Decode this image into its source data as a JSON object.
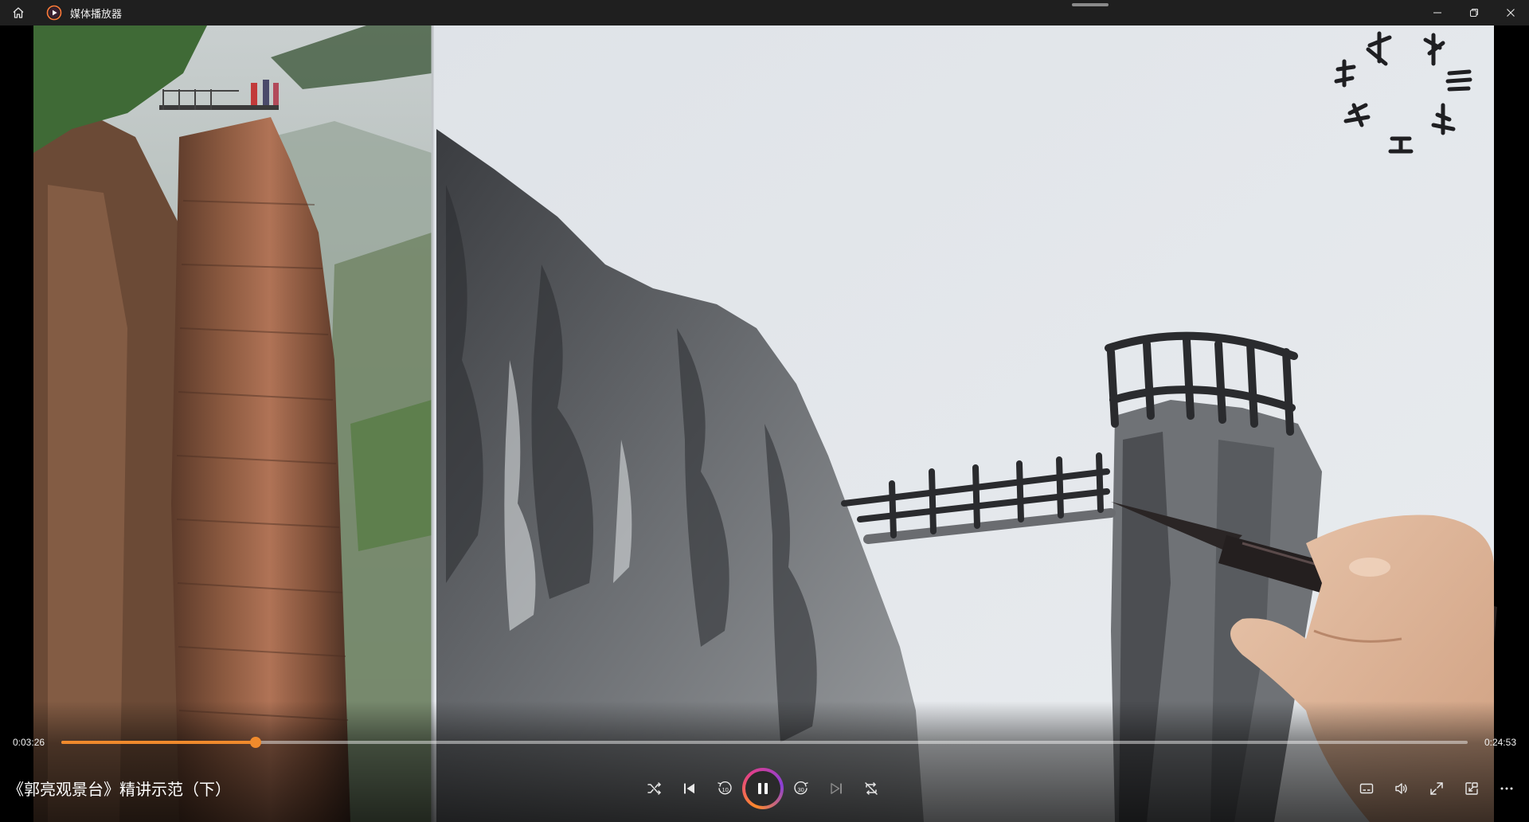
{
  "app": {
    "title": "媒体播放器",
    "home_icon": "home-icon",
    "app_icon": "media-player-icon",
    "window_controls": [
      "minimize-icon",
      "restore-icon",
      "close-icon"
    ]
  },
  "video": {
    "overlay_brush_text": [
      "米",
      "字",
      "三",
      "木",
      "工",
      "山",
      "之"
    ]
  },
  "playback": {
    "current_time": "0:03:26",
    "duration": "0:24:53",
    "progress": 0.138,
    "accent_color": "#f08a2c",
    "media_title": "《郭亮观景台》精讲示范（下）",
    "state": "playing"
  },
  "transport_controls": {
    "shuffle": "shuffle-icon",
    "previous": "previous-icon",
    "rewind": "rewind-10-icon",
    "play_pause": "pause-icon",
    "forward": "forward-30-icon",
    "next": "next-icon",
    "repeat": "repeat-off-icon"
  },
  "right_controls": {
    "captions": "captions-icon",
    "volume": "volume-icon",
    "fullscreen": "fullscreen-icon",
    "mini_player": "mini-player-icon",
    "more": "more-icon"
  }
}
